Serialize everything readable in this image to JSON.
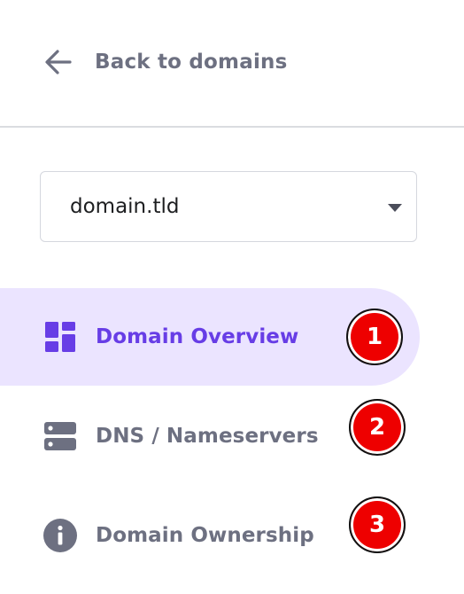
{
  "back": {
    "label": "Back to domains",
    "icon": "arrow-left-icon"
  },
  "domain_select": {
    "value": "domain.tld",
    "icon": "caret-down-icon"
  },
  "nav": {
    "items": [
      {
        "label": "Domain Overview",
        "icon": "dashboard-icon",
        "active": true,
        "badge": "1"
      },
      {
        "label": "DNS / Nameservers",
        "icon": "server-icon",
        "active": false,
        "badge": "2"
      },
      {
        "label": "Domain Ownership",
        "icon": "info-icon",
        "active": false,
        "badge": "3"
      }
    ]
  },
  "colors": {
    "accent": "#673de6",
    "active_bg": "#ebe4ff",
    "muted_text": "#6d7081",
    "badge": "#ee0000"
  }
}
